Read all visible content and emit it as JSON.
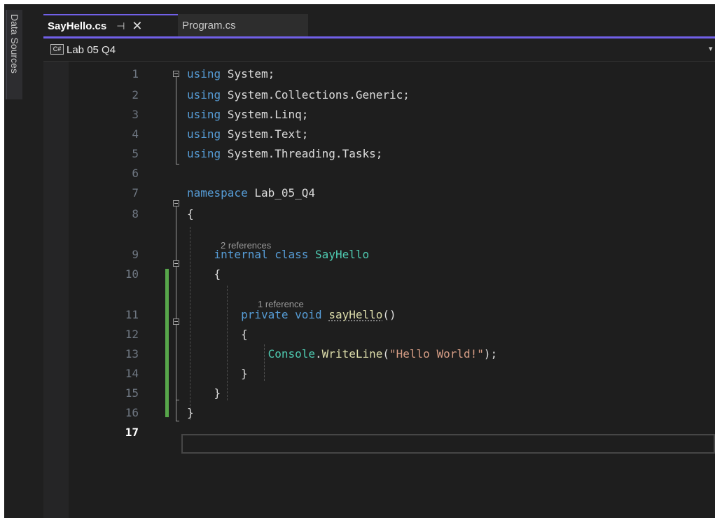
{
  "side_panel": {
    "label": "Data Sources"
  },
  "tabs": {
    "active": {
      "label": "SayHello.cs",
      "pin_glyph": "⊣",
      "close_glyph": "✕"
    },
    "inactive": {
      "label": "Program.cs"
    }
  },
  "nav": {
    "language_badge": "C#",
    "project": "Lab 05 Q4",
    "dropdown_glyph": "▾"
  },
  "editor": {
    "line_numbers": [
      "1",
      "2",
      "3",
      "4",
      "5",
      "6",
      "7",
      "8",
      "9",
      "10",
      "11",
      "12",
      "13",
      "14",
      "15",
      "16",
      "17"
    ],
    "current_line": "17",
    "code_lens": {
      "class_refs": "2 references",
      "method_refs": "1 reference"
    },
    "lines": [
      [
        {
          "t": "kw",
          "v": "using"
        },
        {
          "t": "pl",
          "v": " System;"
        }
      ],
      [
        {
          "t": "kw",
          "v": "using"
        },
        {
          "t": "pl",
          "v": " System.Collections.Generic;"
        }
      ],
      [
        {
          "t": "kw",
          "v": "using"
        },
        {
          "t": "pl",
          "v": " System.Linq;"
        }
      ],
      [
        {
          "t": "kw",
          "v": "using"
        },
        {
          "t": "pl",
          "v": " System.Text;"
        }
      ],
      [
        {
          "t": "kw",
          "v": "using"
        },
        {
          "t": "pl",
          "v": " System.Threading.Tasks;"
        }
      ],
      [],
      [
        {
          "t": "kw",
          "v": "namespace"
        },
        {
          "t": "pl",
          "v": " Lab_05_Q4"
        }
      ],
      [
        {
          "t": "pl",
          "v": "{"
        }
      ],
      [
        {
          "t": "pl",
          "v": "    "
        },
        {
          "t": "kw",
          "v": "internal"
        },
        {
          "t": "pl",
          "v": " "
        },
        {
          "t": "kw",
          "v": "class"
        },
        {
          "t": "pl",
          "v": " "
        },
        {
          "t": "ty",
          "v": "SayHello"
        }
      ],
      [
        {
          "t": "pl",
          "v": "    {"
        }
      ],
      [
        {
          "t": "pl",
          "v": "        "
        },
        {
          "t": "kw",
          "v": "private"
        },
        {
          "t": "pl",
          "v": " "
        },
        {
          "t": "kw",
          "v": "void"
        },
        {
          "t": "pl",
          "v": " "
        },
        {
          "t": "fn",
          "v": "sayHello"
        },
        {
          "t": "pl",
          "v": "()"
        }
      ],
      [
        {
          "t": "pl",
          "v": "        {"
        }
      ],
      [
        {
          "t": "pl",
          "v": "            "
        },
        {
          "t": "ty",
          "v": "Console"
        },
        {
          "t": "pl",
          "v": "."
        },
        {
          "t": "fn",
          "v": "WriteLine"
        },
        {
          "t": "pl",
          "v": "("
        },
        {
          "t": "st",
          "v": "\"Hello World!\""
        },
        {
          "t": "pl",
          "v": ");"
        }
      ],
      [
        {
          "t": "pl",
          "v": "        }"
        }
      ],
      [
        {
          "t": "pl",
          "v": "    }"
        }
      ],
      [
        {
          "t": "pl",
          "v": "}"
        }
      ],
      []
    ]
  },
  "colors": {
    "keyword": "#569cd6",
    "type": "#4ec9b0",
    "method": "#dcdcaa",
    "string": "#d69d85",
    "text": "#dcdcdc",
    "line_number": "#6e7681",
    "accent": "#7160e8",
    "changed_lines": "#57a64a"
  }
}
